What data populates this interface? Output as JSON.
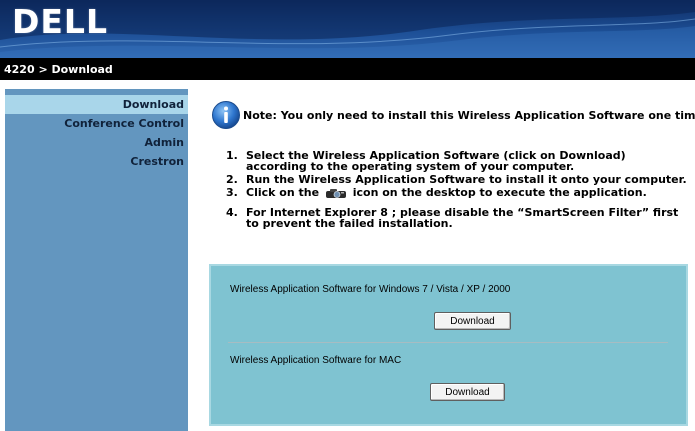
{
  "header": {
    "logo_text": "DELL",
    "brand_color": "#1d4f96"
  },
  "breadcrumb": "4220 > Download",
  "sidebar": {
    "items": [
      {
        "label": "Download",
        "active": true
      },
      {
        "label": "Conference Control",
        "active": false
      },
      {
        "label": "Admin",
        "active": false
      },
      {
        "label": "Crestron",
        "active": false
      }
    ]
  },
  "note": {
    "icon": "info-icon",
    "text": "Note: You only need to install this Wireless Application Software one time."
  },
  "steps": [
    {
      "num": "1.",
      "text": "Select the Wireless Application Software (click on Download) according to the operating system of your computer."
    },
    {
      "num": "2.",
      "text": "Run the Wireless Application Software to install it onto your computer."
    },
    {
      "num": "3.",
      "pre": "Click on the",
      "icon": "camera-icon",
      "post": "icon on the desktop to execute the application."
    },
    {
      "num": "4.",
      "text": "For Internet Explorer 8 ; please disable the “SmartScreen Filter” first to prevent the failed installation."
    }
  ],
  "downloads": [
    {
      "label": "Wireless Application Software for Windows 7 / Vista / XP / 2000",
      "button": "Download"
    },
    {
      "label": "Wireless Application Software for MAC",
      "button": "Download"
    }
  ]
}
